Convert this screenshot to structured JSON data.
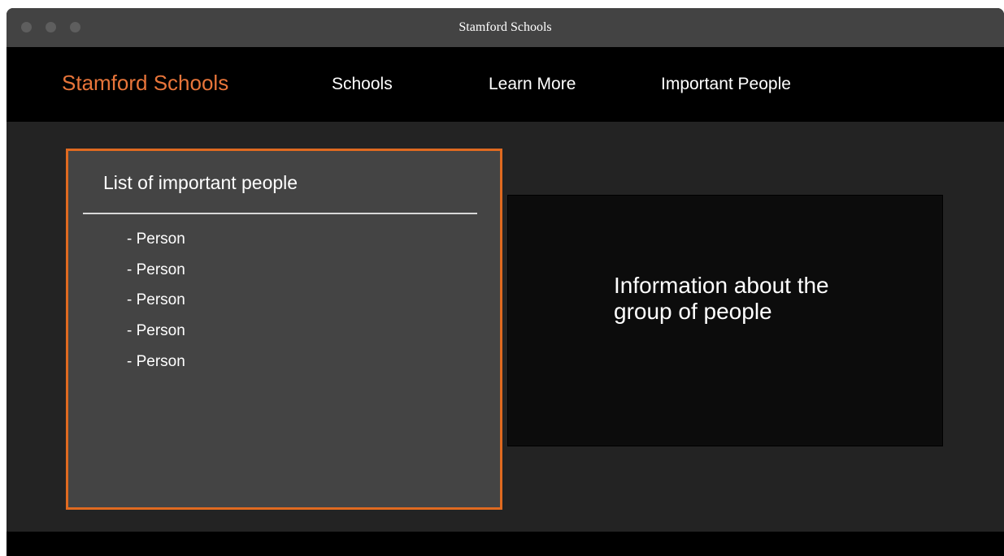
{
  "window": {
    "title": "Stamford Schools"
  },
  "navbar": {
    "brand": "Stamford Schools",
    "links": [
      {
        "label": "Schools"
      },
      {
        "label": "Learn More"
      },
      {
        "label": "Important People"
      }
    ]
  },
  "people_panel": {
    "heading": "List of important people",
    "items": [
      "- Person",
      "- Person",
      "- Person",
      "- Person",
      "- Person"
    ]
  },
  "info_panel": {
    "text": "Information about the group of people"
  },
  "colors": {
    "accent": "#e06a20",
    "brand_text": "#e8753a",
    "navbar_bg": "#000000",
    "content_bg": "#232323",
    "panel_bg": "#444444",
    "info_bg": "#0c0c0c"
  }
}
